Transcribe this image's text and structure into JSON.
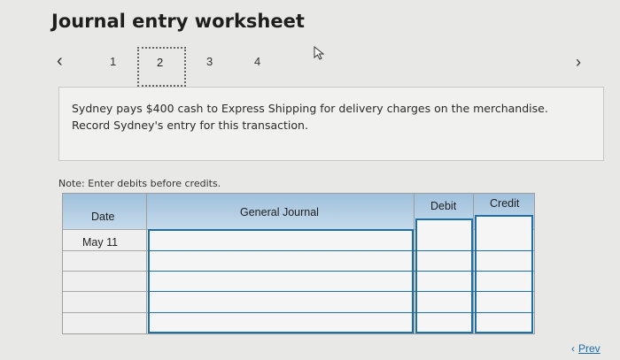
{
  "title": "Journal entry worksheet",
  "pager": {
    "pages": [
      "1",
      "2",
      "3",
      "4"
    ],
    "current": "2"
  },
  "prompt": "Sydney pays $400 cash to Express Shipping for delivery charges on the merchandise. Record Sydney's entry for this transaction.",
  "note": "Note: Enter debits before credits.",
  "journal": {
    "headers": {
      "date": "Date",
      "general_journal": "General Journal",
      "debit": "Debit",
      "credit": "Credit"
    },
    "rows": [
      {
        "date": "May 11",
        "account": "",
        "debit": "",
        "credit": ""
      },
      {
        "date": "",
        "account": "",
        "debit": "",
        "credit": ""
      },
      {
        "date": "",
        "account": "",
        "debit": "",
        "credit": ""
      },
      {
        "date": "",
        "account": "",
        "debit": "",
        "credit": ""
      },
      {
        "date": "",
        "account": "",
        "debit": "",
        "credit": ""
      },
      {
        "date": "",
        "account": "",
        "debit": "",
        "credit": ""
      }
    ]
  },
  "nav": {
    "prev_label": "Prev"
  },
  "colors": {
    "header_blue": "#9fc0dc",
    "field_border": "#1c6fa8",
    "link": "#1c6fa8"
  }
}
